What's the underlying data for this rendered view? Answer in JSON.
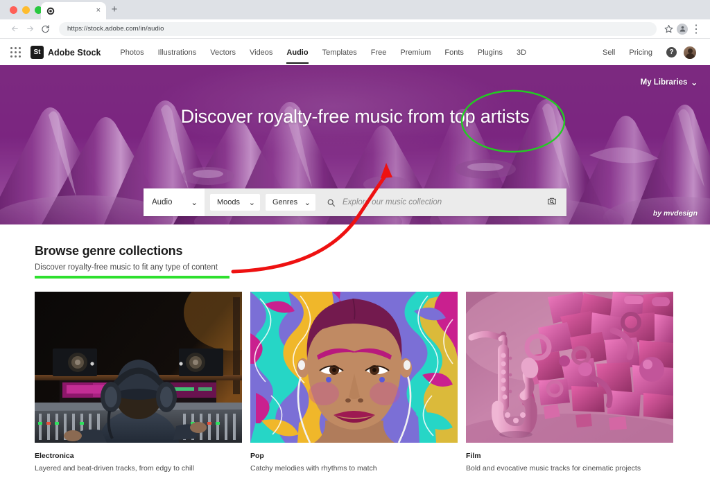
{
  "browser": {
    "tab": {
      "title": "",
      "favicon_icon": "adobe-stock-favicon",
      "close_icon": "×"
    },
    "new_tab_icon": "+",
    "back_icon": "←",
    "forward_icon": "→",
    "reload_icon": "⟳",
    "url": "https://stock.adobe.com/in/audio",
    "bookmark_icon": "star-icon",
    "profile_icon": "profile-icon",
    "menu_icon": "⋮"
  },
  "sitenav": {
    "apps_icon": "app-grid-icon",
    "logo_mark": "St",
    "logo_text": "Adobe Stock",
    "links": [
      {
        "label": "Photos",
        "active": false
      },
      {
        "label": "Illustrations",
        "active": false
      },
      {
        "label": "Vectors",
        "active": false
      },
      {
        "label": "Videos",
        "active": false
      },
      {
        "label": "Audio",
        "active": true
      },
      {
        "label": "Templates",
        "active": false
      },
      {
        "label": "Free",
        "active": false
      },
      {
        "label": "Premium",
        "active": false
      },
      {
        "label": "Fonts",
        "active": false
      },
      {
        "label": "Plugins",
        "active": false
      },
      {
        "label": "3D",
        "active": false
      }
    ],
    "right_links": [
      {
        "label": "Sell"
      },
      {
        "label": "Pricing"
      }
    ],
    "help_label": "?",
    "avatar_icon": "user-avatar"
  },
  "hero": {
    "my_libraries": "My Libraries",
    "my_libraries_chevron": "⌄",
    "title": "Discover royalty-free music from top artists",
    "watermark": "by mvdesign",
    "search": {
      "type_value": "Audio",
      "type_chevron": "⌄",
      "filters": [
        {
          "label": "Moods",
          "chevron": "⌄"
        },
        {
          "label": "Genres",
          "chevron": "⌄"
        }
      ],
      "search_icon": "search-icon",
      "placeholder": "Explore our music collection",
      "camera_icon": "visual-search-camera-icon"
    }
  },
  "browse": {
    "heading": "Browse genre collections",
    "subheading": "Discover royalty-free music to fit any type of content",
    "cards": [
      {
        "title": "Electronica",
        "description": "Layered and beat-driven tracks, from edgy to chill",
        "image_name": "studio-engineer-mixing-console-photo"
      },
      {
        "title": "Pop",
        "description": "Catchy melodies with rhythms to match",
        "image_name": "psychedelic-woman-earbuds-illustration"
      },
      {
        "title": "Film",
        "description": "Bold and evocative music tracks for cinematic projects",
        "image_name": "pink-saxophone-3d-render"
      }
    ]
  },
  "annotations": {
    "circle_color": "#22cc22",
    "underline_color": "#2ee02e",
    "arrow_color": "#ee1111"
  }
}
